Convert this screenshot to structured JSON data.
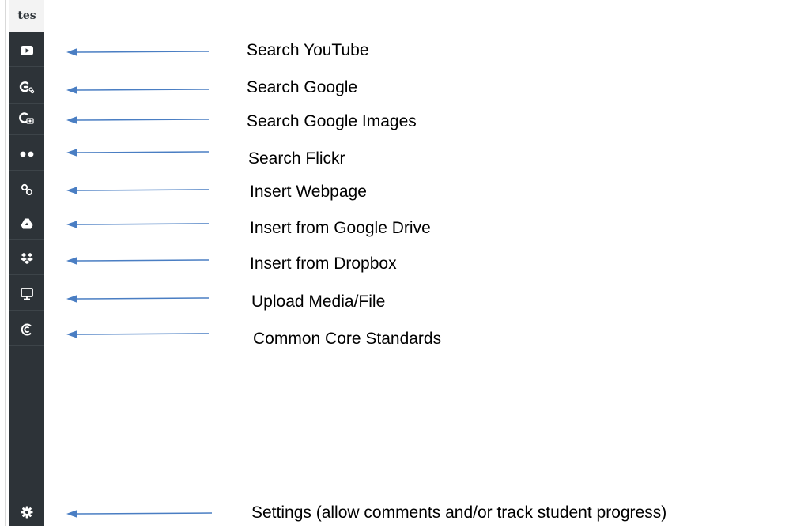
{
  "sidebar": {
    "logo": "tes",
    "items": [
      {
        "icon": "youtube-icon"
      },
      {
        "icon": "google-search-icon"
      },
      {
        "icon": "google-images-icon"
      },
      {
        "icon": "flickr-icon"
      },
      {
        "icon": "link-icon"
      },
      {
        "icon": "google-drive-icon"
      },
      {
        "icon": "dropbox-icon"
      },
      {
        "icon": "monitor-icon"
      },
      {
        "icon": "common-core-icon"
      }
    ],
    "settings_icon": "gear-icon"
  },
  "annotations": [
    "Search YouTube",
    "Search Google",
    "Search Google Images",
    "Search Flickr",
    "Insert Webpage",
    "Insert from Google Drive",
    "Insert from Dropbox",
    "Upload Media/File",
    "Common Core Standards",
    "Settings (allow comments and/or track student progress)"
  ],
  "colors": {
    "sidebar": "#2d3338",
    "arrow": "#4a7ec3",
    "logo_bg": "#f3f3f3"
  }
}
